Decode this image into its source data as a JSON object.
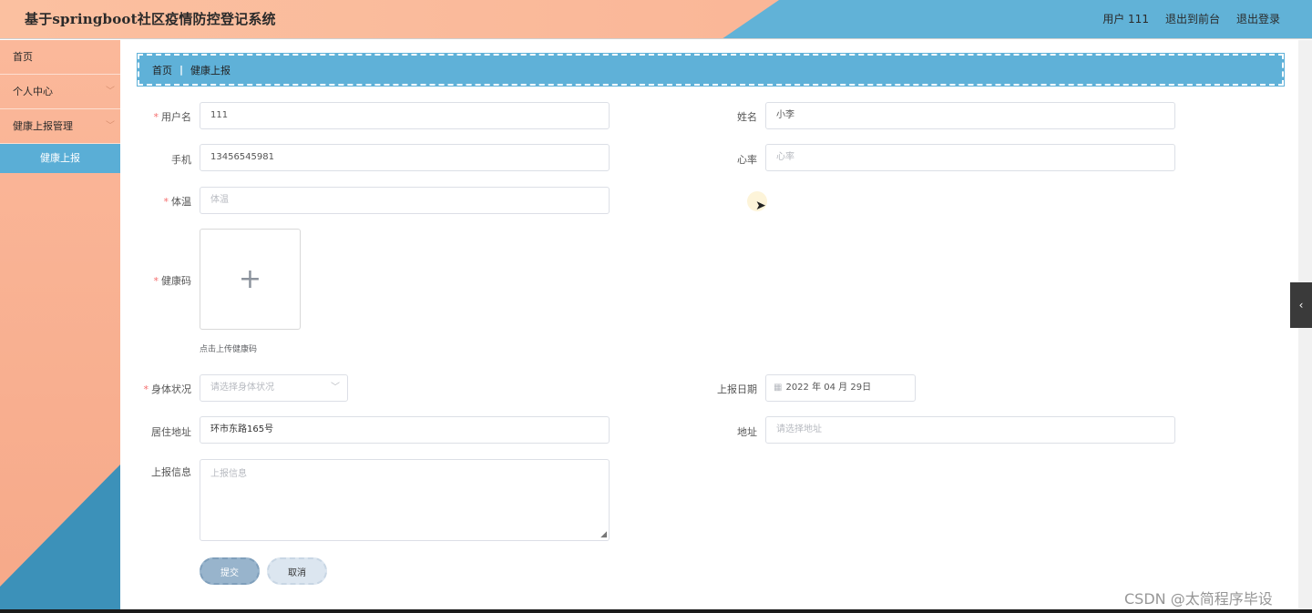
{
  "app": {
    "title": "基于springboot社区疫情防控登记系统"
  },
  "header": {
    "user_label": "用户 111",
    "front_link": "退出到前台",
    "logout_link": "退出登录"
  },
  "sidebar": {
    "items": [
      {
        "label": "首页"
      },
      {
        "label": "个人中心",
        "icon": "chevron-down-icon"
      },
      {
        "label": "健康上报管理",
        "icon": "chevron-down-icon"
      }
    ],
    "sub_items": [
      {
        "label": "健康上报",
        "active": true
      }
    ]
  },
  "breadcrumb": {
    "home": "首页",
    "current": "健康上报"
  },
  "form": {
    "username": {
      "label": "用户名",
      "value": "111",
      "required": true
    },
    "name": {
      "label": "姓名",
      "value": "小李"
    },
    "phone": {
      "label": "手机",
      "value": "13456545981"
    },
    "heart_rate": {
      "label": "心率",
      "placeholder": "心率"
    },
    "temperature": {
      "label": "体温",
      "placeholder": "体温",
      "required": true
    },
    "health_code": {
      "label": "健康码",
      "required": true,
      "upload_tip": "点击上传健康码",
      "icon": "plus-icon"
    },
    "body_status": {
      "label": "身体状况",
      "placeholder": "请选择身体状况",
      "required": true
    },
    "report_date": {
      "label": "上报日期",
      "value": "2022 年 04 月 29日",
      "icon": "calendar-icon"
    },
    "residence": {
      "label": "居住地址",
      "value": "环市东路165号"
    },
    "address": {
      "label": "地址",
      "placeholder": "请选择地址"
    },
    "report_info": {
      "label": "上报信息",
      "placeholder": "上报信息"
    },
    "submit_label": "提交",
    "cancel_label": "取消"
  },
  "watermark": "CSDN @太简程序毕设",
  "colors": {
    "header_peach": "#fbc0a0",
    "header_blue": "#61b2d7",
    "sidebar_active": "#5aaed6",
    "required": "#f56c6c"
  }
}
